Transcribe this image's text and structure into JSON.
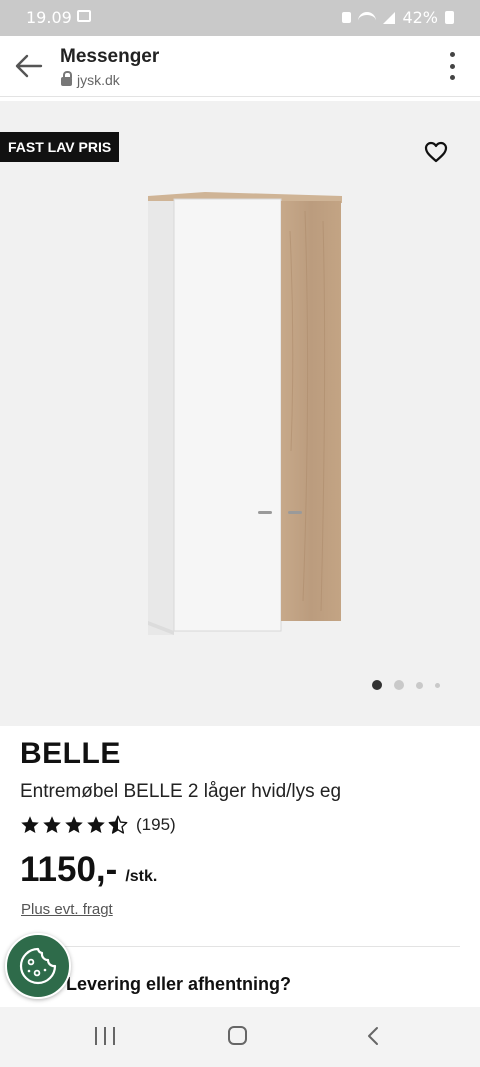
{
  "status_bar": {
    "time": "19.09",
    "battery": "42%"
  },
  "browser": {
    "title": "Messenger",
    "url": "jysk.dk"
  },
  "product": {
    "badge": "FAST LAV PRIS",
    "brand": "BELLE",
    "description": "Entremøbel BELLE 2 låger hvid/lys eg",
    "rating_stars": 4.5,
    "rating_count": "(195)",
    "price": "1150,-",
    "unit": "/stk.",
    "freight_link": "Plus evt. fragt",
    "image_pages": 4,
    "active_image": 1
  },
  "delivery_heading": "Levering eller afhentning?",
  "colors": {
    "badge_bg": "#111111",
    "cookie_bg": "#2e6b4a",
    "image_bg": "#f1f1f1"
  },
  "icons": [
    "back-arrow-icon",
    "lock-icon",
    "kebab-menu-icon",
    "heart-icon",
    "star-icon",
    "cookie-icon",
    "recent-apps-icon",
    "home-icon",
    "back-icon"
  ]
}
